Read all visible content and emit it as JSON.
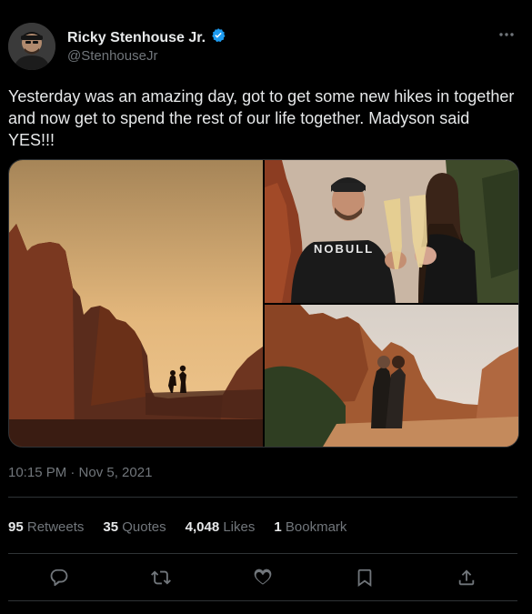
{
  "user": {
    "display_name": "Ricky Stenhouse Jr.",
    "handle": "@StenhouseJr",
    "verified": true
  },
  "tweet": {
    "text": "Yesterday was an amazing day, got to get some new hikes in together and now get to spend the rest of our life together. Madyson said YES!!!",
    "timestamp": "10:15 PM · Nov 5, 2021",
    "shirt_text": "NOBULL"
  },
  "stats": {
    "retweets_count": "95",
    "retweets_label": "Retweets",
    "quotes_count": "35",
    "quotes_label": "Quotes",
    "likes_count": "4,048",
    "likes_label": "Likes",
    "bookmarks_count": "1",
    "bookmarks_label": "Bookmark"
  },
  "colors": {
    "background": "#000000",
    "text_primary": "#e7e9ea",
    "text_secondary": "#71767b",
    "verified": "#1d9bf0",
    "divider": "#2f3336"
  },
  "icons": [
    "verified-badge-icon",
    "more-icon",
    "reply-icon",
    "retweet-icon",
    "like-icon",
    "bookmark-icon",
    "share-icon"
  ]
}
